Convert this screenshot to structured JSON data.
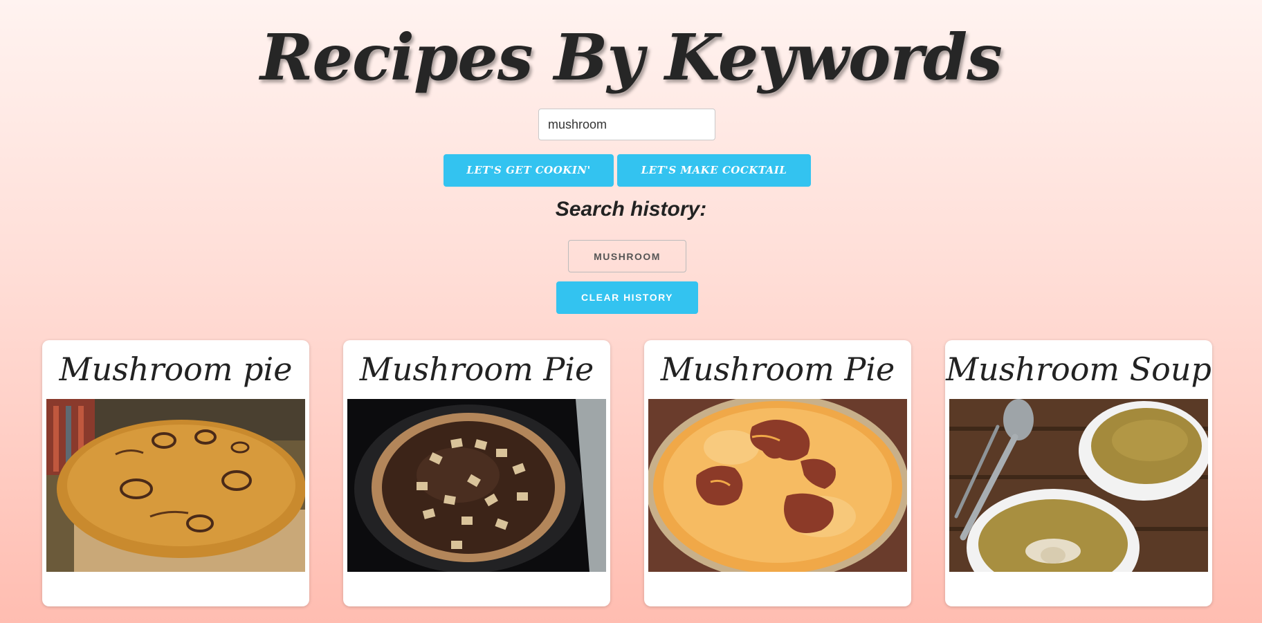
{
  "header": {
    "title": "Recipes By Keywords"
  },
  "search": {
    "value": "mushroom"
  },
  "buttons": {
    "cook_label": "LET'S GET COOKIN'",
    "cocktail_label": "LET'S MAKE COCKTAIL",
    "clear_label": "CLEAR HISTORY"
  },
  "history": {
    "heading": "Search history:",
    "items": [
      "MUSHROOM"
    ]
  },
  "recipes": [
    {
      "title": "Mushroom pie",
      "image": "pie-with-onion-rings-photo"
    },
    {
      "title": "Mushroom Pie",
      "image": "chocolate-pie-photo"
    },
    {
      "title": "Mushroom Pie",
      "image": "golden-crust-pie-photo"
    },
    {
      "title": "Mushroom Soup",
      "image": "mushroom-soup-bowls-photo"
    }
  ],
  "colors": {
    "accent": "#33c3f0",
    "background_top": "#fff3f0",
    "background_bottom": "#ffbdb1"
  }
}
